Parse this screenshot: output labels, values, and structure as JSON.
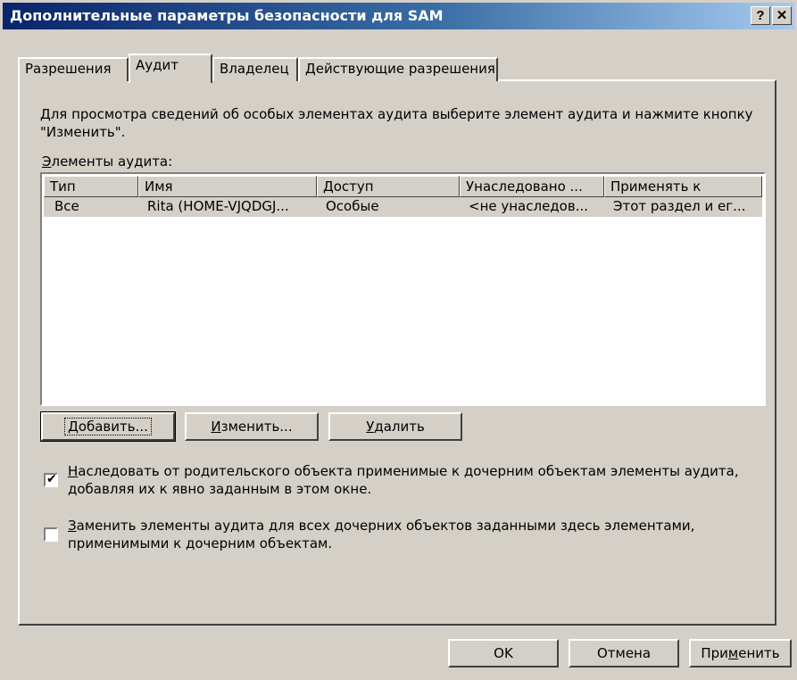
{
  "window": {
    "title": "Дополнительные параметры безопасности для SAM",
    "help_button": "?",
    "close_button": "✕"
  },
  "tabs": [
    {
      "label": "Разрешения"
    },
    {
      "label": "Аудит"
    },
    {
      "label": "Владелец"
    },
    {
      "label": "Действующие разрешения"
    }
  ],
  "audit": {
    "description": "Для просмотра сведений об особых элементах аудита выберите элемент аудита и нажмите кнопку \"Изменить\".",
    "list_label_accel": "Э",
    "list_label_rest": "лементы аудита:",
    "columns": [
      "Тип",
      "Имя",
      "Доступ",
      "Унаследовано ...",
      "Применять к"
    ],
    "rows": [
      [
        "Все",
        "Rita (HOME-VJQDGJ...",
        "Особые",
        "<не унаследов...",
        "Этот раздел и ег..."
      ]
    ],
    "buttons": {
      "add_accel": "Д",
      "add_rest": "обавить...",
      "edit_accel": "И",
      "edit_rest": "зменить...",
      "delete_accel": "У",
      "delete_rest": "далить"
    },
    "inherit_checkbox": {
      "checked": true,
      "accel": "Н",
      "rest": "аследовать от родительского объекта применимые к дочерним объектам элементы аудита, добавляя их к явно заданным в этом окне."
    },
    "replace_checkbox": {
      "checked": false,
      "accel": "З",
      "rest": "аменить элементы аудита для всех дочерних объектов заданными здесь элементами, применимыми к дочерним объектам."
    }
  },
  "footer": {
    "ok": "OK",
    "cancel": "Отмена",
    "apply_pre": "При",
    "apply_accel": "м",
    "apply_post": "енить"
  }
}
